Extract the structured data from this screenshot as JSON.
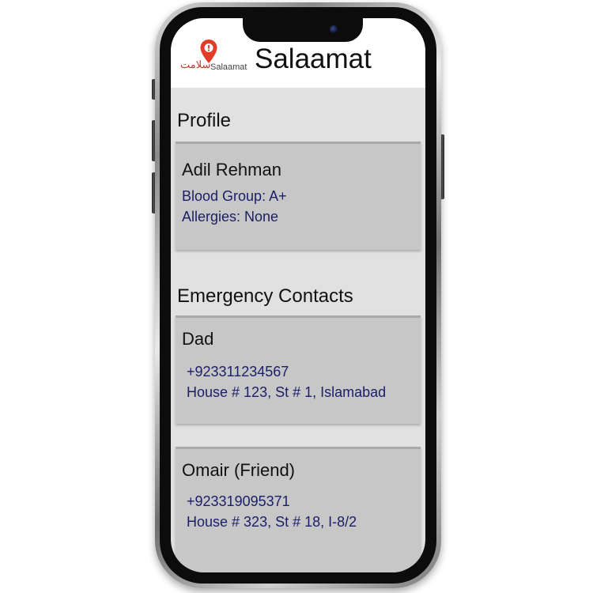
{
  "app": {
    "title": "Salaamat",
    "logo_urdu": "سلامت",
    "logo_text": "Salaamat"
  },
  "profile": {
    "section_title": "Profile",
    "name": "Adil Rehman",
    "blood_group": "Blood Group: A+",
    "allergies": "Allergies: None"
  },
  "emergency": {
    "section_title": "Emergency Contacts",
    "contacts": [
      {
        "name": "Dad",
        "phone": "+923311234567",
        "address": "House # 123, St # 1, Islamabad"
      },
      {
        "name": "Omair (Friend)",
        "phone": "+923319095371",
        "address": "House # 323, St # 18, I-8/2"
      }
    ]
  },
  "colors": {
    "accent": "#e23b27",
    "detail_text": "#1c2068",
    "card_bg": "#c7c7c7",
    "page_bg": "#e2e1e2"
  }
}
